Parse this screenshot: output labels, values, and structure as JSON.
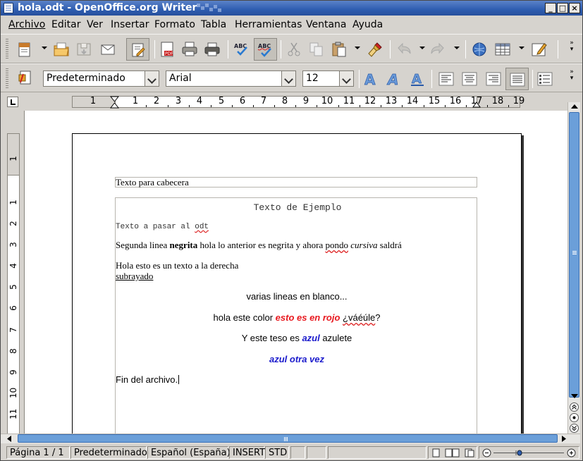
{
  "window": {
    "title": "hola.odt - OpenOffice.org Writer",
    "controls": {
      "minimize": "_",
      "maximize": "□",
      "close": "×"
    }
  },
  "menu": {
    "items": [
      {
        "label": "Archivo"
      },
      {
        "label": "Editar"
      },
      {
        "label": "Ver"
      },
      {
        "label": "Insertar"
      },
      {
        "label": "Formato"
      },
      {
        "label": "Tabla"
      },
      {
        "label": "Herramientas"
      },
      {
        "label": "Ventana"
      },
      {
        "label": "Ayuda"
      }
    ]
  },
  "toolbar": {
    "icons": [
      "new-document-icon",
      "open-folder-icon",
      "save-icon",
      "email-icon",
      "edit-mode-icon",
      "export-pdf-icon",
      "print-icon",
      "print-preview-icon",
      "spellcheck-icon",
      "autospellcheck-icon",
      "cut-icon",
      "copy-icon",
      "paste-icon",
      "format-paintbrush-icon",
      "undo-icon",
      "redo-icon",
      "navigator-icon",
      "table-icon",
      "show-draw-functions-icon"
    ]
  },
  "formatting": {
    "style": "Predeterminado",
    "font": "Arial",
    "size": "12"
  },
  "ruler": {
    "ticks": [
      "1",
      "1",
      "2",
      "3",
      "4",
      "5",
      "6",
      "7",
      "8",
      "9",
      "10",
      "11",
      "12",
      "13",
      "14",
      "15",
      "16",
      "17",
      "18",
      "19"
    ],
    "vticks": [
      "1",
      "1",
      "2",
      "3",
      "4",
      "5",
      "6",
      "7",
      "8",
      "9",
      "10",
      "11"
    ]
  },
  "document": {
    "header_text": "Texto para cabecera",
    "title": "Texto de Ejemplo",
    "line1_prefix": "Texto a pasar al ",
    "line1_odt": "odt",
    "line2_a": "Segunda linea ",
    "line2_bold": "negrita",
    "line2_b": " hola lo anterior es negrita y ahora ",
    "line2_pondo": "pondo",
    "line2_c": " ",
    "line2_italic": "cursiva",
    "line2_d": " saldrá",
    "line3": "Hola esto es un texto a la derecha",
    "line4_underlined": "subrayado",
    "line5": "varias lineas en blanco...",
    "line6_a": "hola este color ",
    "line6_red": "esto es en rojo",
    "line6_b": " ",
    "line6_c": "¿váéúle",
    "line6_d": "?",
    "line7_a": "Y este teso es ",
    "line7_blue": "azul",
    "line7_b": " azulete",
    "line8_blue": "azul otra vez",
    "line9": "Fin del archivo."
  },
  "colors": {
    "red": "#e8191f",
    "blue": "#1a1acc",
    "titlebar": "#2e5db0"
  },
  "status": {
    "page": "Página  1 / 1",
    "style": "Predeterminado",
    "language": "Español (España)",
    "insert": "INSERT",
    "std": "STD"
  }
}
